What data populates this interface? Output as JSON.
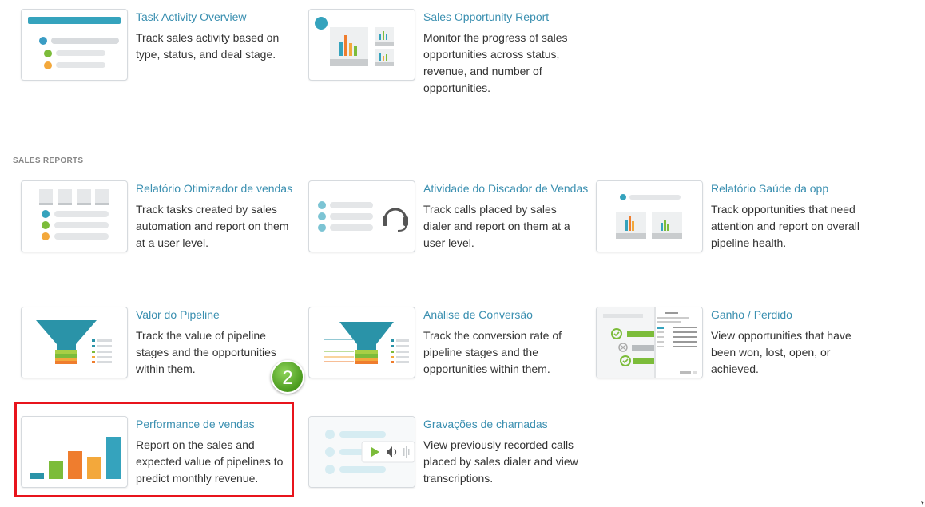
{
  "section_label": "SALES REPORTS",
  "step_badge": "2",
  "cards": [
    {
      "title": "Task Activity Overview",
      "desc": "Track sales activity based on type, status, and deal stage."
    },
    {
      "title": "Sales Opportunity Report",
      "desc": "Monitor the progress of sales opportunities across status, revenue, and number of opportunities."
    },
    {
      "title": "Relatório Otimizador de vendas",
      "desc": "Track tasks created by sales automation and report on them at a user level."
    },
    {
      "title": "Atividade do Discador de Vendas",
      "desc": "Track calls placed by sales dialer and report on them at a user level."
    },
    {
      "title": "Relatório Saúde da opp",
      "desc": "Track opportunities that need attention and report on overall pipeline health."
    },
    {
      "title": "Valor do Pipeline",
      "desc": "Track the value of pipeline stages and the opportunities within them."
    },
    {
      "title": "Análise de Conversão",
      "desc": "Track the conversion rate of pipeline stages and the opportunities within them."
    },
    {
      "title": "Ganho / Perdido",
      "desc": "View opportunities that have been won, lost, open, or achieved."
    },
    {
      "title": "Performance de vendas",
      "desc": "Report on the sales and expected value of pipelines to predict monthly revenue."
    },
    {
      "title": "Gravações de chamadas",
      "desc": "View previously recorded calls placed by sales dialer and view transcriptions."
    }
  ],
  "colors": {
    "link": "#3a8fb0",
    "highlight": "#e8141c",
    "badge": "#4a9a1e",
    "teal": "#2a93a8",
    "green": "#7cbc3a",
    "orange": "#ef7d2e",
    "yellow": "#f3a83b"
  }
}
